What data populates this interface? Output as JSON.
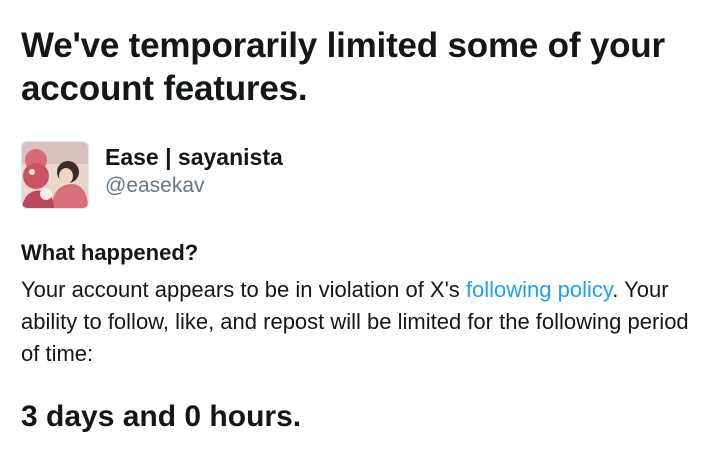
{
  "headline": "We've temporarily limited some of your account features.",
  "account": {
    "avatar_icon": "user-photo-avatar",
    "display_name": "Ease | sayanista",
    "handle": "@easekav"
  },
  "notice": {
    "section_title": "What happened?",
    "text_before_link": "Your account appears to be in violation of X's ",
    "link_text": "following policy",
    "text_after_link": ". Your ability to follow, like, and repost will be limited for the following period of time:",
    "duration": "3 days and 0 hours."
  },
  "colors": {
    "text": "#14171a",
    "handle": "#657786",
    "link": "#1da1f2",
    "background": "#ffffff"
  }
}
